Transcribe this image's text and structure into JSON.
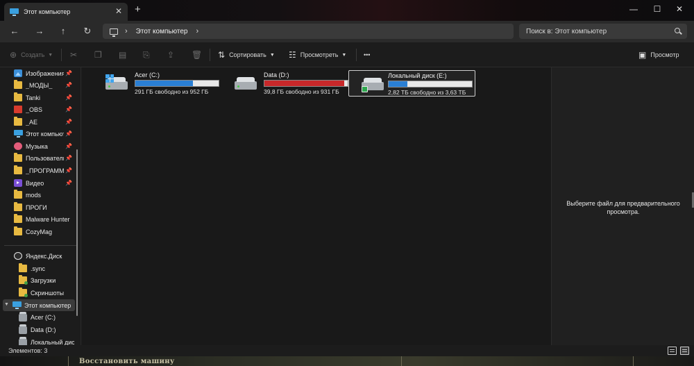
{
  "tab": {
    "label": "Этот компьютер",
    "close": "✕",
    "new": "+"
  },
  "window_controls": {
    "minimize": "—",
    "maximize": "☐",
    "close": "✕"
  },
  "nav": {
    "back": "←",
    "forward": "→",
    "up": "↑",
    "refresh": "↻"
  },
  "address": {
    "location": "Этот компьютер",
    "chevron": "›"
  },
  "search": {
    "placeholder": "Поиск в: Этот компьютер"
  },
  "commands": {
    "create": "Создать",
    "sort": "Сортировать",
    "view": "Просмотреть",
    "more": "•••",
    "preview": "Просмотр"
  },
  "sidebar": {
    "items": [
      {
        "label": "Изображения",
        "icon": "image-icon",
        "pinned": true
      },
      {
        "label": "_МОДЫ_",
        "icon": "folder-icon",
        "pinned": true
      },
      {
        "label": "Tanki",
        "icon": "folder-icon",
        "pinned": true
      },
      {
        "label": "_OBS",
        "icon": "red-folder-icon",
        "pinned": true
      },
      {
        "label": "_AE",
        "icon": "folder-icon",
        "pinned": true
      },
      {
        "label": "Этот компьютер",
        "icon": "monitor-icon",
        "pinned": true
      },
      {
        "label": "Музыка",
        "icon": "music-icon",
        "pinned": true
      },
      {
        "label": "Пользователи",
        "icon": "folder-icon",
        "pinned": true
      },
      {
        "label": "_ПРОГРАММЫ",
        "icon": "folder-icon",
        "pinned": true
      },
      {
        "label": "Видео",
        "icon": "video-icon",
        "pinned": true
      },
      {
        "label": "mods",
        "icon": "folder-icon",
        "pinned": false
      },
      {
        "label": "ПРОГИ",
        "icon": "folder-icon",
        "pinned": false
      },
      {
        "label": "Malware Hunter",
        "icon": "folder-icon",
        "pinned": false
      },
      {
        "label": "CozyMag",
        "icon": "folder-icon",
        "pinned": false
      }
    ],
    "tree": [
      {
        "label": "Яндекс.Диск",
        "icon": "yandex-disk-icon"
      },
      {
        "label": ".sync",
        "icon": "folder-icon"
      },
      {
        "label": "Загрузки",
        "icon": "synced-folder-icon"
      },
      {
        "label": "Скриншоты",
        "icon": "synced-folder-icon"
      },
      {
        "label": "Этот компьютер",
        "icon": "monitor-icon"
      },
      {
        "label": "Acer (C:)",
        "icon": "drive-icon"
      },
      {
        "label": "Data (D:)",
        "icon": "drive-icon"
      },
      {
        "label": "Локальный диск (E:)",
        "icon": "drive-icon"
      }
    ]
  },
  "drives": [
    {
      "name": "Acer (C:)",
      "free": "291 ГБ свободно из 952 ГБ",
      "used_fraction": 0.694,
      "color": "#2a7fd4",
      "type": "system"
    },
    {
      "name": "Data (D:)",
      "free": "39,8 ГБ свободно из 931 ГБ",
      "used_fraction": 0.957,
      "color": "#c8282a",
      "type": "data"
    },
    {
      "name": "Локальный диск (E:)",
      "free": "2,82 ТБ свободно из 3,63 ТБ",
      "used_fraction": 0.223,
      "color": "#2a7fd4",
      "type": "usb"
    }
  ],
  "preview_pane": {
    "message": "Выберите файл для предварительного просмотра."
  },
  "status": {
    "items": "Элементов: 3"
  },
  "desktop": {
    "text": "Восстановить машину"
  }
}
